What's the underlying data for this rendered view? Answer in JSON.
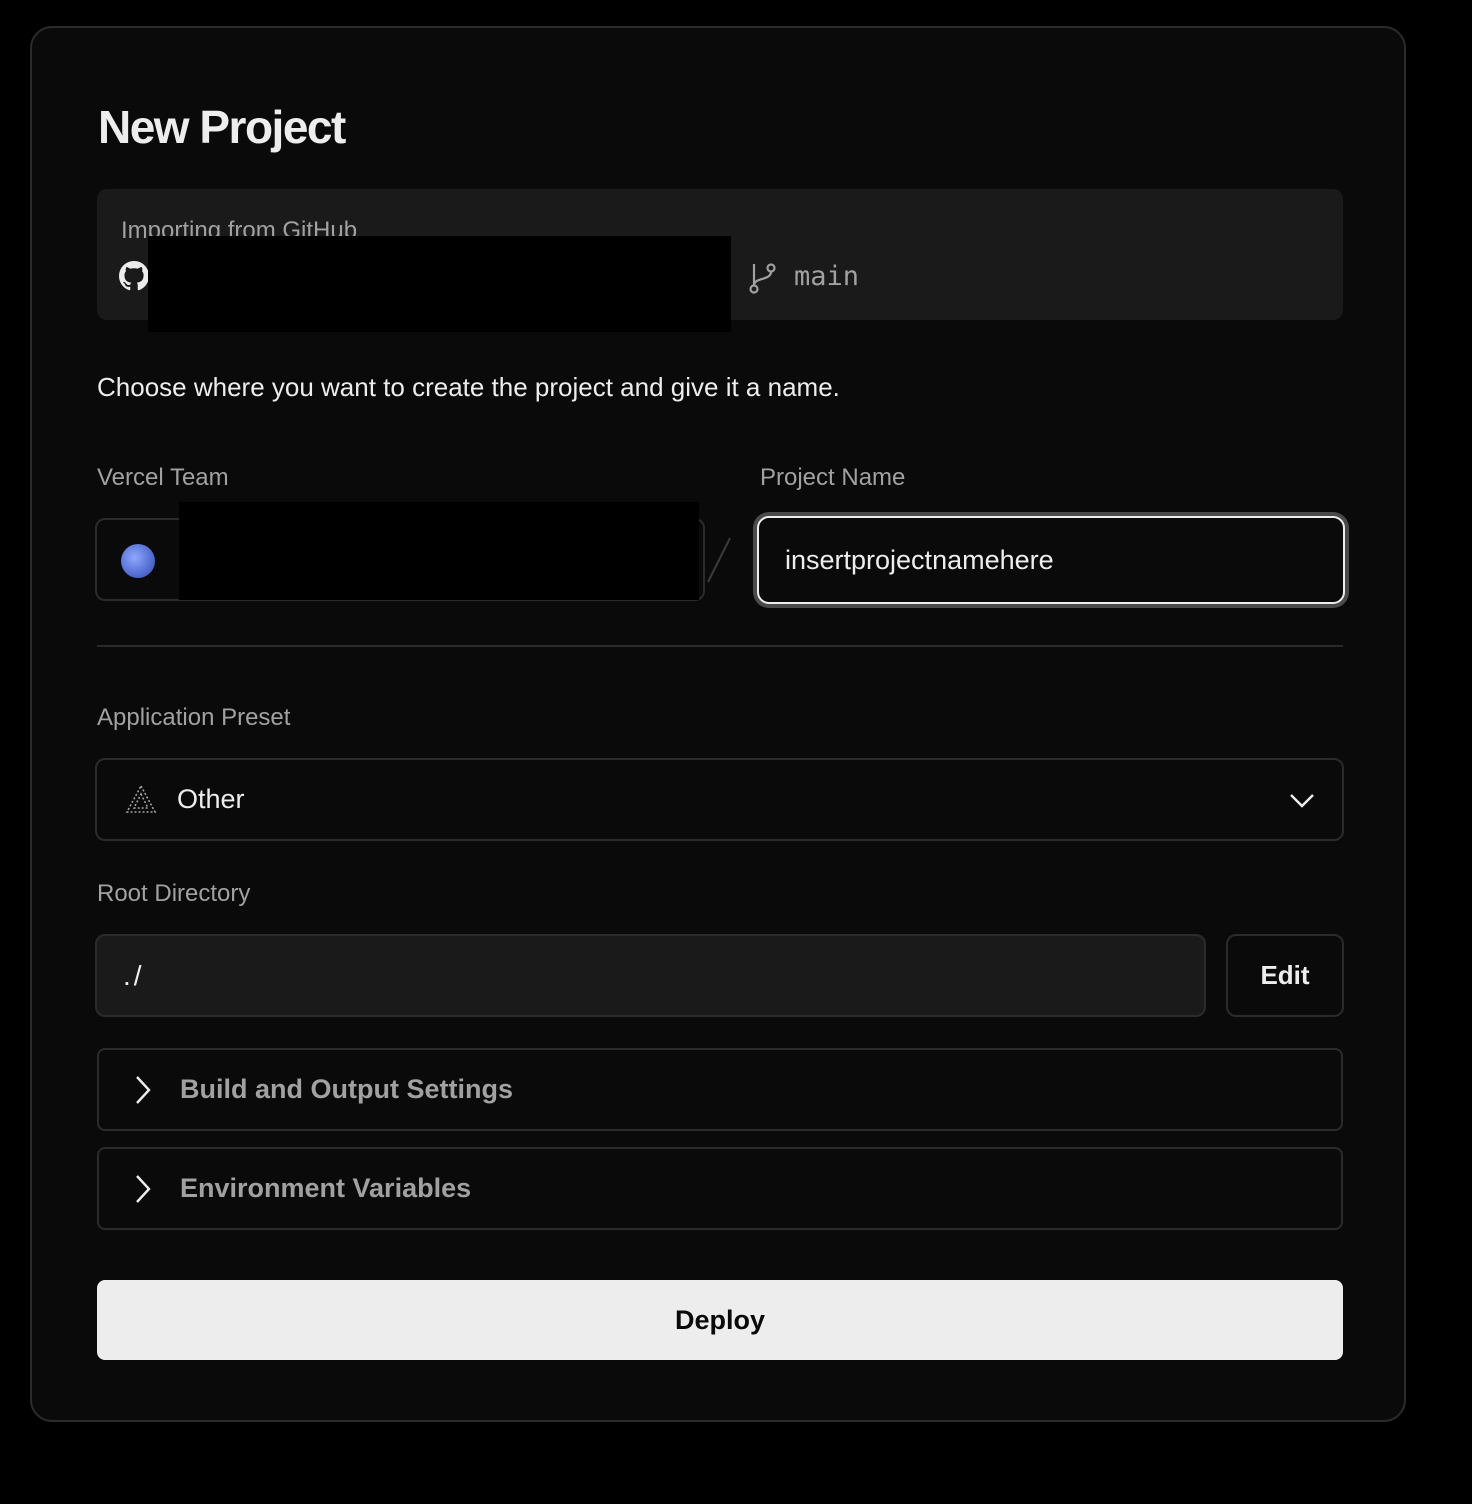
{
  "title": "New Project",
  "import": {
    "label": "Importing from GitHub",
    "branch": "main"
  },
  "description": "Choose where you want to create the project and give it a name.",
  "team": {
    "label": "Vercel Team"
  },
  "project_name": {
    "label": "Project Name",
    "value": "insertprojectnamehere"
  },
  "preset": {
    "label": "Application Preset",
    "value": "Other"
  },
  "root": {
    "label": "Root Directory",
    "value": "./",
    "edit_label": "Edit"
  },
  "sections": {
    "build": "Build and Output Settings",
    "env": "Environment Variables"
  },
  "deploy_label": "Deploy"
}
